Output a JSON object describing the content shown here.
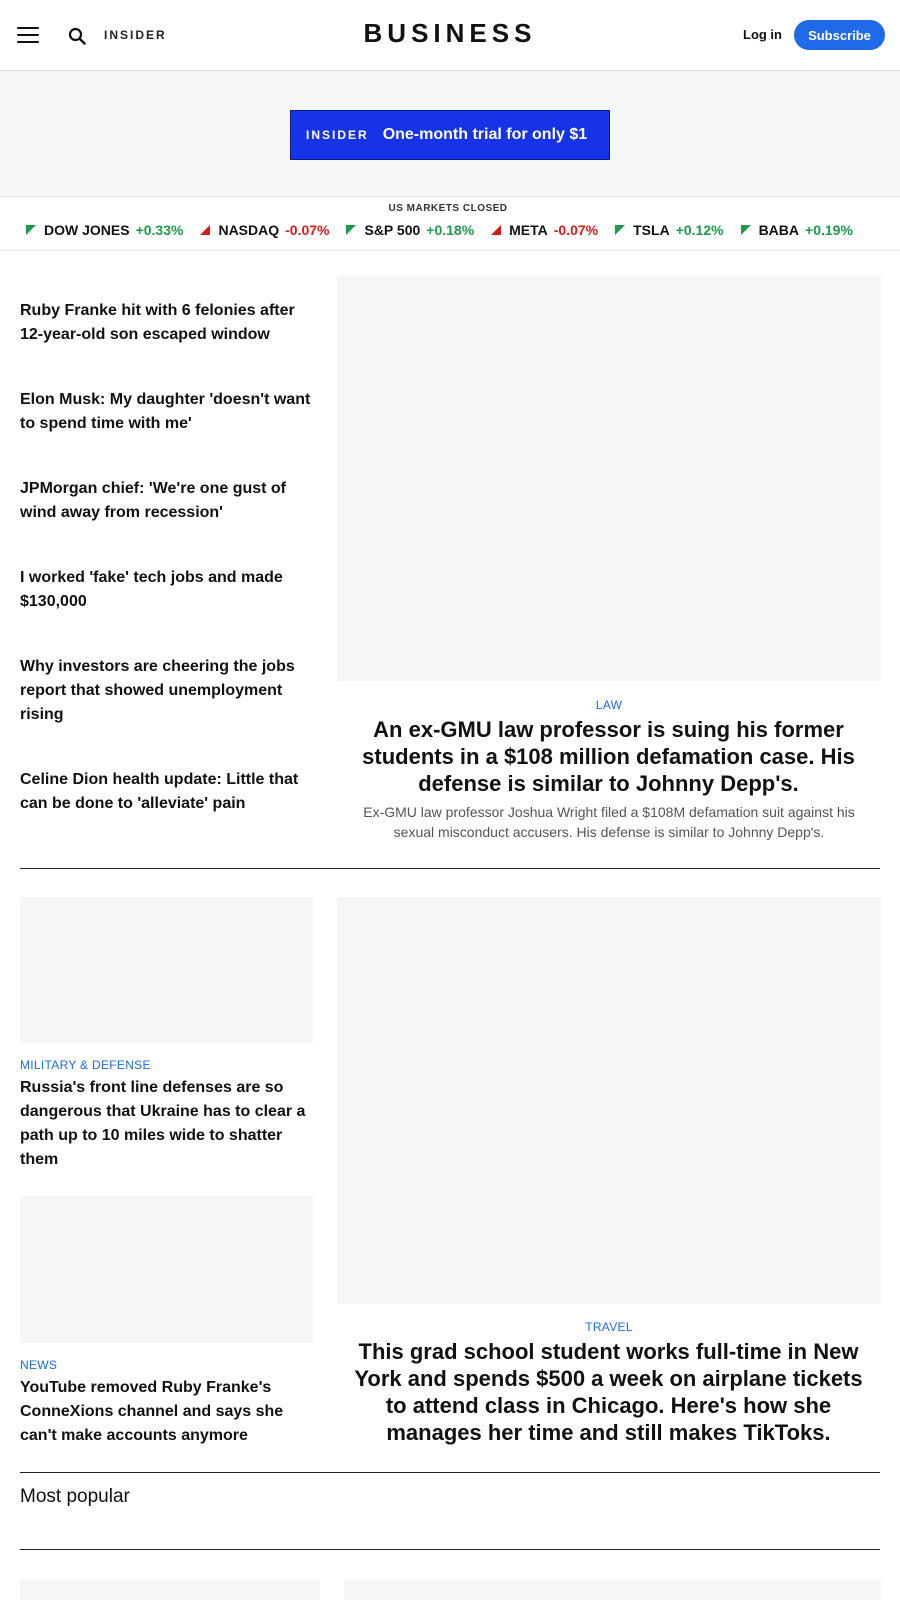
{
  "header": {
    "insider_label": "INSIDER",
    "brand": "BUSINESS",
    "login_label": "Log in",
    "subscribe_label": "Subscribe"
  },
  "promo": {
    "brand": "INSIDER",
    "text": "One-month trial for only $1"
  },
  "markets": {
    "status": "US MARKETS CLOSED",
    "tickers": [
      {
        "symbol": "DOW JONES",
        "change": "+0.33%"
      },
      {
        "symbol": "NASDAQ",
        "change": "-0.07%"
      },
      {
        "symbol": "S&P 500",
        "change": "+0.18%"
      },
      {
        "symbol": "META",
        "change": "-0.07%"
      },
      {
        "symbol": "TSLA",
        "change": "+0.12%"
      },
      {
        "symbol": "BABA",
        "change": "+0.19%"
      }
    ]
  },
  "headlines": [
    "Ruby Franke hit with 6 felonies after 12-year-old son escaped window",
    "Elon Musk: My daughter 'doesn't want to spend time with me'",
    "JPMorgan chief: 'We're one gust of wind away from recession'",
    "I worked 'fake' tech jobs and made $130,000",
    "Why investors are cheering the jobs report that showed unemployment rising",
    "Celine Dion health update: Little that can be done to 'alleviate' pain"
  ],
  "feature1": {
    "category": "LAW",
    "title": "An ex-GMU law professor is suing his former students in a $108 million defamation case. His defense is similar to Johnny Depp's.",
    "description": "Ex-GMU law professor Joshua Wright filed a $108M defamation suit against his sexual misconduct accusers. His defense is similar to Johnny Depp's."
  },
  "cards": [
    {
      "category": "MILITARY & DEFENSE",
      "title": "Russia's front line defenses are so dangerous that Ukraine has to clear a path up to 10 miles wide to shatter them"
    },
    {
      "category": "NEWS",
      "title": "YouTube removed Ruby Franke's ConneXions channel and says she can't make accounts anymore"
    }
  ],
  "feature2": {
    "category": "TRAVEL",
    "title": "This grad school student works full-time in New York and spends $500 a week on airplane tickets to attend class in Chicago. Here's how she manages her time and still makes TikToks."
  },
  "most_popular_label": "Most popular",
  "colors": {
    "accent": "#1e6ae8",
    "promo_bg": "#1733e6",
    "market_up": "#1f9a4c",
    "market_down": "#d91a1a"
  }
}
